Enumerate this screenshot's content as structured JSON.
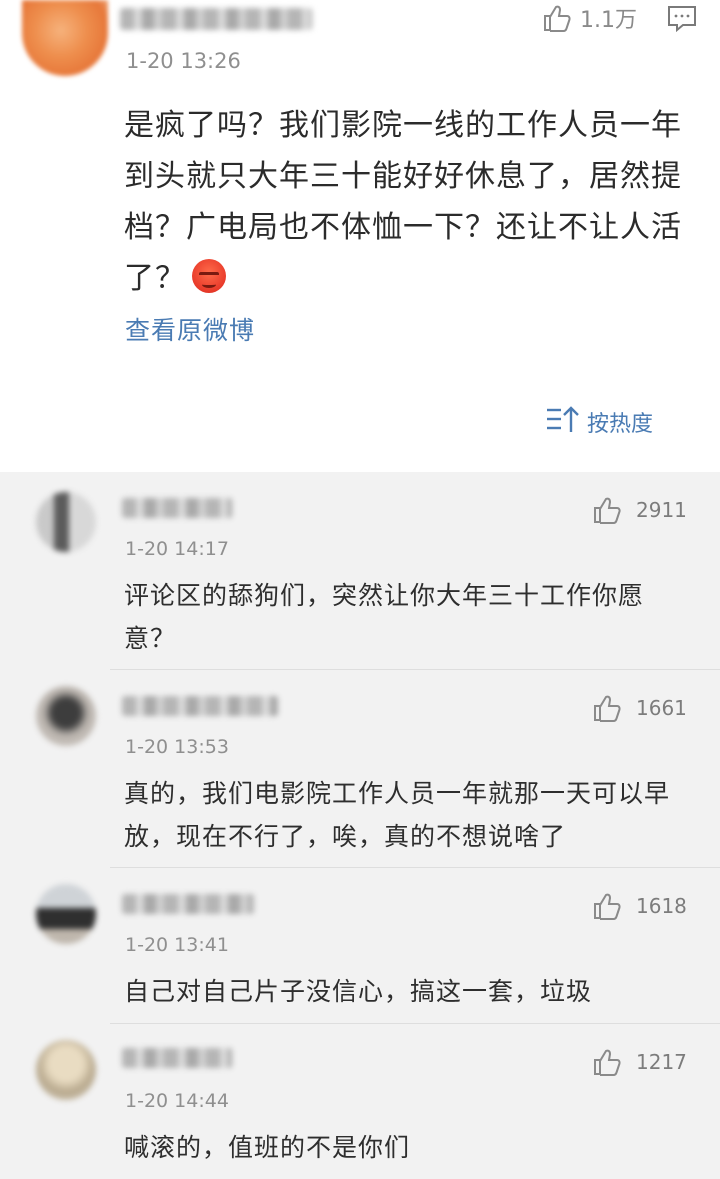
{
  "main_post": {
    "like_count": "1.1万",
    "time": "1-20 13:26",
    "text": "是疯了吗？我们影院一线的工作人员一年到头就只大年三十能好好休息了，居然提档？广电局也不体恤一下？还让不让人活了？",
    "view_original": "查看原微博"
  },
  "sort": {
    "label": "按热度"
  },
  "comments": [
    {
      "time": "1-20 14:17",
      "likes": "2911",
      "text": "评论区的舔狗们，突然让你大年三十工作你愿意？"
    },
    {
      "time": "1-20 13:53",
      "likes": "1661",
      "text": "真的，我们电影院工作人员一年就那一天可以早放，现在不行了，唉，真的不想说啥了"
    },
    {
      "time": "1-20 13:41",
      "likes": "1618",
      "text": "自己对自己片子没信心，搞这一套，垃圾"
    },
    {
      "time": "1-20 14:44",
      "likes": "1217",
      "text": "喊滚的，值班的不是你们"
    }
  ],
  "colors": {
    "link": "#4a7bb3",
    "background": "#f2f2f2",
    "card": "#ffffff"
  }
}
